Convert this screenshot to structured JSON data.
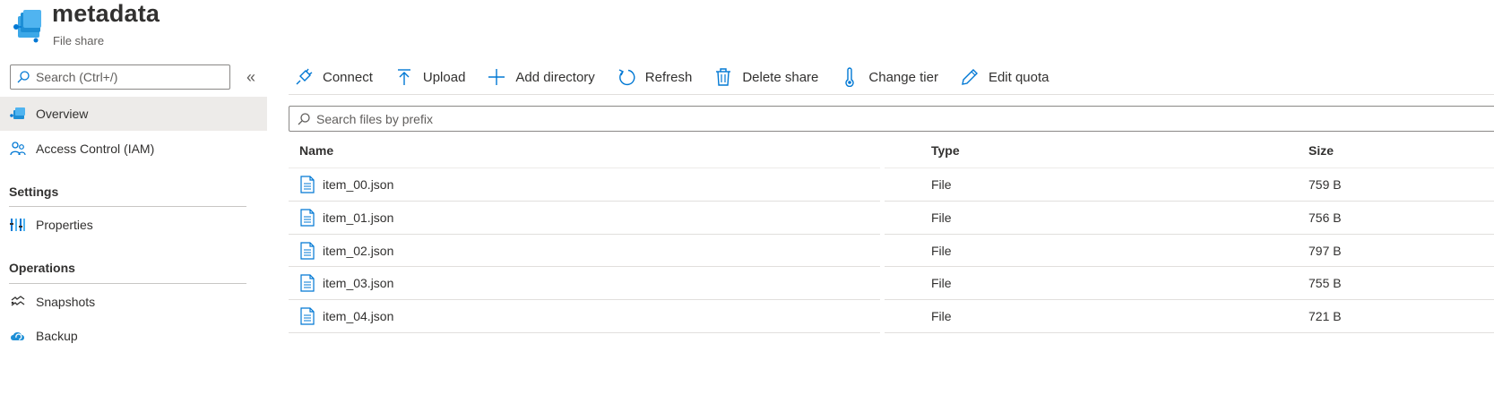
{
  "header": {
    "title": "metadata",
    "subtitle": "File share"
  },
  "sidebar": {
    "search_placeholder": "Search (Ctrl+/)",
    "collapse_glyph": "«",
    "items": [
      {
        "label": "Overview",
        "icon": "file-share-icon",
        "active": true
      },
      {
        "label": "Access Control (IAM)",
        "icon": "people-icon",
        "active": false
      }
    ],
    "sections": [
      {
        "title": "Settings",
        "items": [
          {
            "label": "Properties",
            "icon": "properties-icon"
          }
        ]
      },
      {
        "title": "Operations",
        "items": [
          {
            "label": "Snapshots",
            "icon": "snapshots-icon"
          },
          {
            "label": "Backup",
            "icon": "backup-cloud-icon"
          }
        ]
      }
    ]
  },
  "toolbar": {
    "connect": "Connect",
    "upload": "Upload",
    "add_directory": "Add directory",
    "refresh": "Refresh",
    "delete_share": "Delete share",
    "change_tier": "Change tier",
    "edit_quota": "Edit quota"
  },
  "file_search": {
    "placeholder": "Search files by prefix"
  },
  "table": {
    "columns": [
      "Name",
      "Type",
      "Size"
    ],
    "rows": [
      {
        "name": "item_00.json",
        "type": "File",
        "size": "759 B"
      },
      {
        "name": "item_01.json",
        "type": "File",
        "size": "756 B"
      },
      {
        "name": "item_02.json",
        "type": "File",
        "size": "797 B"
      },
      {
        "name": "item_03.json",
        "type": "File",
        "size": "755 B"
      },
      {
        "name": "item_04.json",
        "type": "File",
        "size": "721 B"
      }
    ]
  },
  "colors": {
    "accent": "#0078d4",
    "active_bg": "#edebe9",
    "text": "#323130"
  }
}
